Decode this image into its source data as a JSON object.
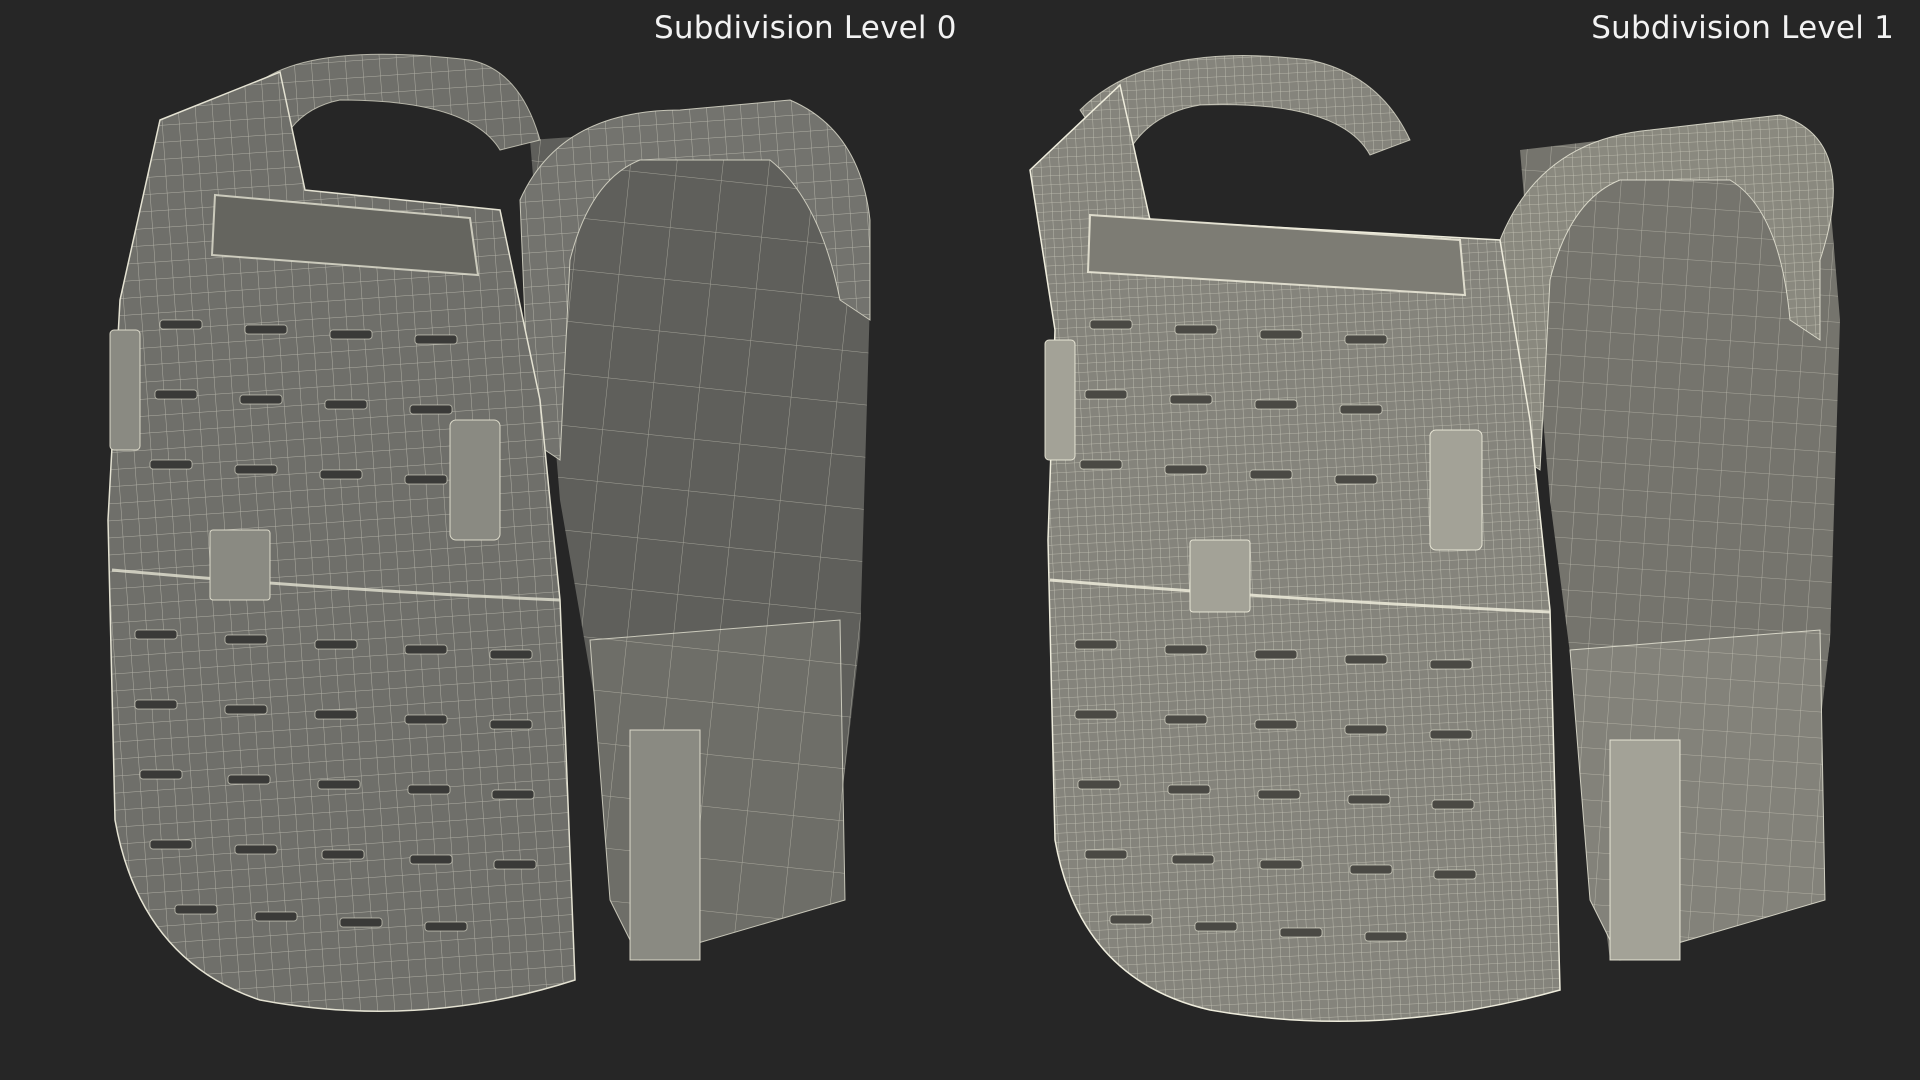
{
  "views": {
    "left": {
      "title": "Subdivision Level 0",
      "subdivision_level": 0
    },
    "right": {
      "title": "Subdivision Level 1",
      "subdivision_level": 1
    }
  },
  "colors": {
    "background": "#262626",
    "vest_fill_level0": "#6f6f6a",
    "vest_fill_level1": "#85847c",
    "wire_level0": "#e4e2d2",
    "wire_level1": "#eeecdc",
    "label_text": "#f2f2f2"
  }
}
